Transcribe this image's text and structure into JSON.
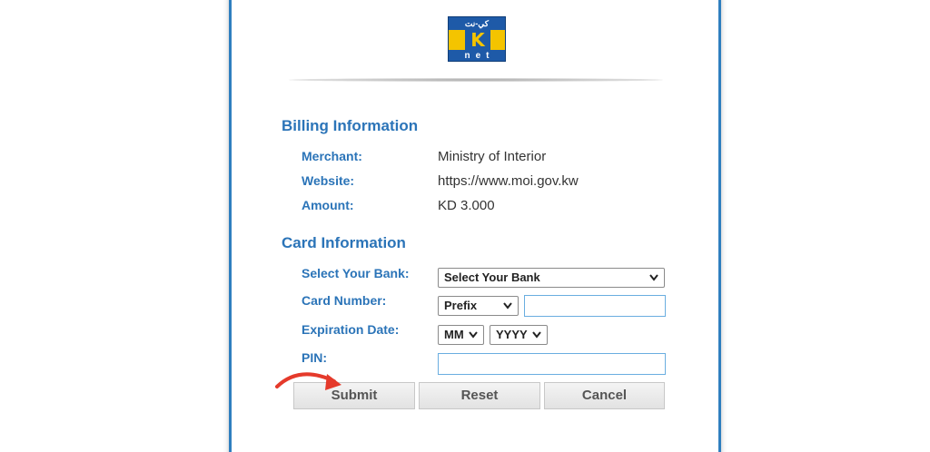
{
  "brand": {
    "logo_top": "كي-نت",
    "logo_letter": "K",
    "logo_bottom": "net",
    "colors": {
      "blue": "#1e5aa8",
      "yellow": "#f4c400",
      "accent": "#2b74b8",
      "arrow": "#e53a2b"
    }
  },
  "billing": {
    "title": "Billing Information",
    "rows": [
      {
        "label": "Merchant:",
        "value": "Ministry of Interior"
      },
      {
        "label": "Website:",
        "value": "https://www.moi.gov.kw"
      },
      {
        "label": "Amount:",
        "value": "KD 3.000"
      }
    ]
  },
  "card": {
    "title": "Card Information",
    "bank_label": "Select Your Bank:",
    "bank_selected": "Select Your Bank",
    "card_number_label": "Card Number:",
    "prefix_selected": "Prefix",
    "card_number_value": "",
    "expiry_label": "Expiration Date:",
    "month_selected": "MM",
    "year_selected": "YYYY",
    "pin_label": "PIN:",
    "pin_value": ""
  },
  "buttons": {
    "submit": "Submit",
    "reset": "Reset",
    "cancel": "Cancel"
  },
  "icons": {
    "dropdown": "chevron-down-icon",
    "annotation": "curved-arrow-icon"
  }
}
